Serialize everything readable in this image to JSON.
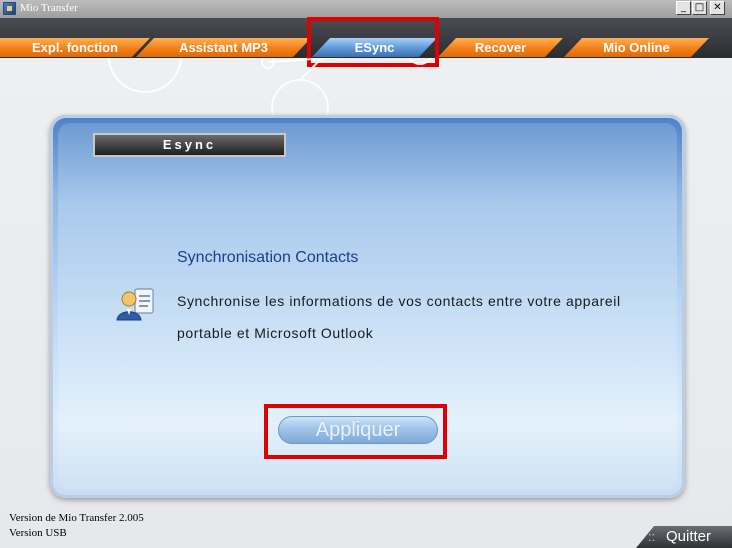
{
  "window": {
    "title": "Mio Transfer",
    "minimize_glyph": "_",
    "maximize_glyph": "□",
    "close_glyph": "✕"
  },
  "tabs": [
    {
      "label": "Expl. fonction"
    },
    {
      "label": "Assistant MP3"
    },
    {
      "label": "ESync"
    },
    {
      "label": "Recover"
    },
    {
      "label": "Mio Online"
    }
  ],
  "panel": {
    "section_label": "Esync",
    "title": "Synchronisation Contacts",
    "description": "Synchronise les informations de vos contacts entre votre appareil portable et Microsoft Outlook",
    "apply_label": "Appliquer"
  },
  "footer": {
    "version_line_1": "Version de Mio Transfer 2.005",
    "version_line_2": "Version USB",
    "quit_dots": "::",
    "quit_label": "Quitter"
  },
  "colors": {
    "accent_orange": "#f47f16",
    "active_tab_blue": "#5c97d6",
    "highlight_red": "#e00000",
    "title_blue": "#1a3d8c"
  },
  "icons": {
    "app": "mio-transfer-icon",
    "contact": "contact-card-icon"
  }
}
